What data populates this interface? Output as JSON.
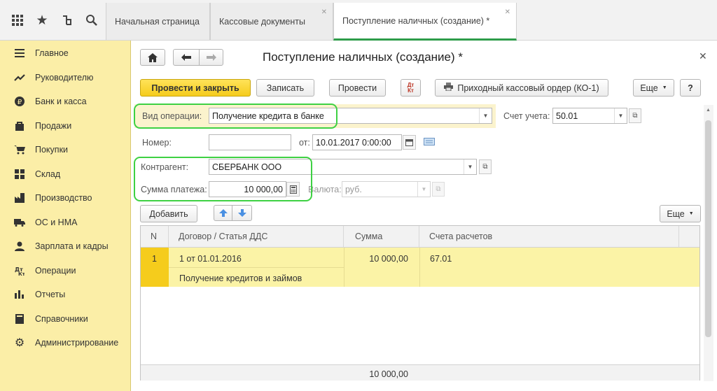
{
  "tabs": [
    {
      "label": "Начальная страница"
    },
    {
      "label": "Кассовые документы"
    },
    {
      "label": "Поступление наличных (создание) *"
    }
  ],
  "sidebar": {
    "items": [
      {
        "label": "Главное",
        "icon": "menu-icon"
      },
      {
        "label": "Руководителю",
        "icon": "trend-icon"
      },
      {
        "label": "Банк и касса",
        "icon": "ruble-icon"
      },
      {
        "label": "Продажи",
        "icon": "bag-icon"
      },
      {
        "label": "Покупки",
        "icon": "cart-icon"
      },
      {
        "label": "Склад",
        "icon": "grid-icon"
      },
      {
        "label": "Производство",
        "icon": "factory-icon"
      },
      {
        "label": "ОС и НМА",
        "icon": "truck-icon"
      },
      {
        "label": "Зарплата и кадры",
        "icon": "people-icon"
      },
      {
        "label": "Операции",
        "icon": "operations-icon"
      },
      {
        "label": "Отчеты",
        "icon": "bars-icon"
      },
      {
        "label": "Справочники",
        "icon": "book-icon"
      },
      {
        "label": "Администрирование",
        "icon": "gear-icon"
      }
    ]
  },
  "form": {
    "title": "Поступление наличных (создание) *",
    "toolbar": {
      "post_close": "Провести и закрыть",
      "save": "Записать",
      "post": "Провести",
      "dtkt": "Дт\nКт",
      "print": "Приходный кассовый ордер (КО-1)",
      "more": "Еще",
      "help": "?"
    },
    "op_type_label": "Вид операции:",
    "op_type_value": "Получение кредита в банке",
    "account_label": "Счет учета:",
    "account_value": "50.01",
    "number_label": "Номер:",
    "number_value": "",
    "date_label": "от:",
    "date_value": "10.01.2017  0:00:00",
    "contractor_label": "Контрагент:",
    "contractor_value": "СБЕРБАНК ООО",
    "amount_label": "Сумма платежа:",
    "amount_value": "10 000,00",
    "currency_label": "Валюта:",
    "currency_value": "руб.",
    "add_button": "Добавить",
    "more_button": "Еще"
  },
  "table": {
    "headers": [
      "N",
      "Договор / Статья ДДС",
      "Сумма",
      "Счета расчетов"
    ],
    "rows": [
      {
        "n": "1",
        "contract": "1 от 01.01.2016",
        "article": "Получение кредитов и займов",
        "sum": "10 000,00",
        "account": "67.01"
      }
    ],
    "total": "10 000,00"
  },
  "colors": {
    "accent": "#f5cc1c",
    "highlight": "#3ed143",
    "sidebar": "#fbeea7",
    "selected_row": "#fbf3a6"
  }
}
